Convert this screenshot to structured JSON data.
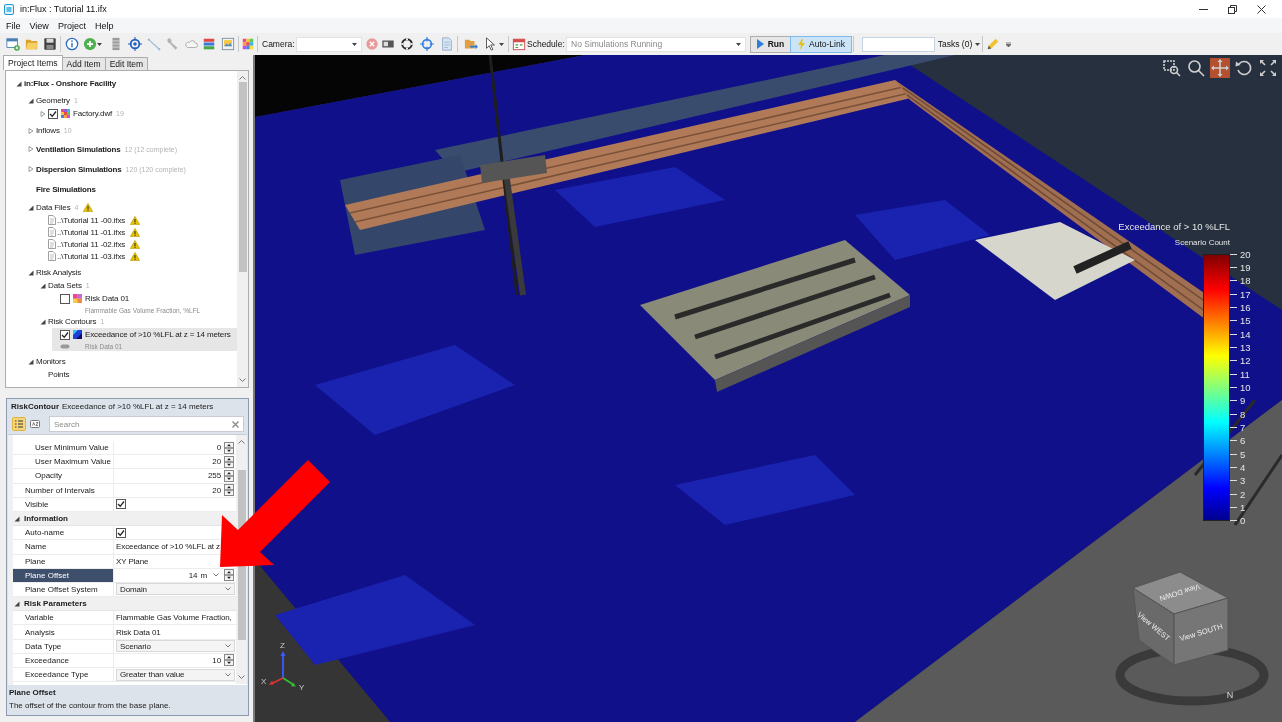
{
  "window": {
    "title": "in:Flux : Tutorial 11.ifx"
  },
  "menu": [
    "File",
    "View",
    "Project",
    "Help"
  ],
  "toolbar": {
    "camera_label": "Camera:",
    "schedule_label": "Schedule:",
    "schedule_value": "No Simulations Running",
    "run_label": "Run",
    "auto_link": {
      "label": "Auto-Link",
      "on": true
    },
    "tasks_label": "Tasks (0)"
  },
  "side_tabs": [
    {
      "label": "Project Items",
      "selected": true
    },
    {
      "label": "Add Item",
      "selected": false
    },
    {
      "label": "Edit Item",
      "selected": false
    }
  ],
  "tree": [
    {
      "label": "in:Flux - Onshore Facility",
      "kind": "root",
      "expanded": true,
      "selected": false,
      "children": [
        {
          "label": "Geometry",
          "kind": "group",
          "count": "1",
          "expanded": true,
          "warning": false,
          "selected": false,
          "children": [
            {
              "label": "Factory.dwf",
              "kind": "model",
              "count": "19",
              "expanded": false,
              "checked": true,
              "selected": false
            }
          ]
        },
        {
          "label": "Inflows",
          "kind": "group",
          "count": "10",
          "expanded": false,
          "warning": false,
          "selected": false
        },
        {
          "label": "Ventilation Simulations",
          "kind": "simulations",
          "count": "12 (12 complete)",
          "expanded": false,
          "warning": false,
          "selected": false
        },
        {
          "label": "Dispersion Simulations",
          "kind": "simulations",
          "count": "120 (120 complete)",
          "expanded": false,
          "warning": false,
          "selected": false
        },
        {
          "label": "Fire Simulations",
          "kind": "simulations",
          "warning": false,
          "selected": false
        },
        {
          "label": "Data Files",
          "kind": "group",
          "count": "4",
          "expanded": true,
          "warning": true,
          "selected": false,
          "children": [
            {
              "label": "..\\Tutorial 11 -00.ifxs",
              "kind": "file",
              "warning": true,
              "selected": false
            },
            {
              "label": "..\\Tutorial 11 -01.ifxs",
              "kind": "file",
              "warning": true,
              "selected": false
            },
            {
              "label": "..\\Tutorial 11 -02.ifxs",
              "kind": "file",
              "warning": true,
              "selected": false
            },
            {
              "label": "..\\Tutorial 11 -03.ifxs",
              "kind": "file",
              "warning": true,
              "selected": false
            }
          ]
        },
        {
          "label": "Risk Analysis",
          "kind": "group",
          "expanded": true,
          "warning": false,
          "selected": false,
          "children": [
            {
              "label": "Data Sets",
              "kind": "group",
              "count": "1",
              "expanded": true,
              "selected": false,
              "children": [
                {
                  "label": "Risk Data 01",
                  "kind": "dataset",
                  "checked": false,
                  "subtitle": "Flammable Gas Volume Fraction, %LFL",
                  "selected": false
                }
              ]
            },
            {
              "label": "Risk Contours",
              "kind": "group",
              "count": "1",
              "expanded": true,
              "selected": false,
              "children": [
                {
                  "label": "Exceedance of >10 %LFL at z = 14 meters",
                  "kind": "contour",
                  "checked": true,
                  "subtitle": "Risk Data 01",
                  "selected": true
                }
              ]
            }
          ]
        },
        {
          "label": "Monitors",
          "kind": "group",
          "expanded": true,
          "warning": false,
          "selected": false,
          "children": [
            {
              "label": "Points",
              "kind": "group",
              "selected": false
            }
          ]
        }
      ]
    }
  ],
  "properties": {
    "header": {
      "type": "RiskContour",
      "name": "Exceedance of >10 %LFL at z = 14 meters"
    },
    "view_modes": [
      {
        "kind": "categorized",
        "selected": true
      },
      {
        "kind": "alphabetical",
        "selected": false
      }
    ],
    "search": {
      "placeholder": "Search"
    },
    "groups": [
      {
        "rows": [
          {
            "kind": "nested",
            "children": [
              {
                "label": "User Minimum Value",
                "kind": "number",
                "value": "0",
                "selected": false
              },
              {
                "label": "User Maximum Value",
                "kind": "number",
                "value": "20",
                "selected": false
              },
              {
                "label": "Opacity",
                "kind": "number",
                "value": "255",
                "selected": false
              }
            ]
          },
          {
            "label": "Number of Intervals",
            "kind": "number",
            "value": "20",
            "selected": false
          },
          {
            "label": "Visible",
            "kind": "check",
            "checked": true,
            "selected": false
          }
        ]
      },
      {
        "title": "Information",
        "expanded": true,
        "rows": [
          {
            "label": "Auto-name",
            "kind": "check",
            "checked": true,
            "selected": false
          },
          {
            "label": "Name",
            "kind": "text",
            "value": "Exceedance of >10 %LFL at z",
            "selected": false
          },
          {
            "label": "Plane",
            "kind": "text",
            "value": "XY Plane",
            "selected": false
          },
          {
            "label": "Plane Offset",
            "kind": "unit-number",
            "value": "14",
            "unit": "m",
            "selected": true
          },
          {
            "label": "Plane Offset System",
            "kind": "dropdown",
            "value": "Domain",
            "selected": false
          }
        ]
      },
      {
        "title": "Risk Parameters",
        "expanded": true,
        "rows": [
          {
            "label": "Variable",
            "kind": "text",
            "value": "Flammable Gas Volume Fraction,",
            "selected": false
          },
          {
            "label": "Analysis",
            "kind": "text",
            "value": "Risk Data 01",
            "selected": false
          },
          {
            "label": "Data Type",
            "kind": "dropdown",
            "value": "Scenario",
            "selected": false
          },
          {
            "label": "Exceedance",
            "kind": "number",
            "value": "10",
            "selected": false
          },
          {
            "label": "Exceedance Type",
            "kind": "dropdown",
            "value": "Greater than value",
            "selected": false
          }
        ]
      }
    ],
    "description": {
      "title": "Plane Offset",
      "text": "The offset of the contour from the base plane."
    }
  },
  "viewport": {
    "tools": [
      {
        "kind": "zoom-window",
        "selected": false
      },
      {
        "kind": "zoom",
        "selected": false
      },
      {
        "kind": "pan",
        "selected": true
      },
      {
        "kind": "rotate",
        "selected": false
      },
      {
        "kind": "fit",
        "selected": false
      }
    ],
    "legend": {
      "title": "Exceedance of > 10 %LFL",
      "subtitle": "Scenario Count",
      "ticks": [
        "20",
        "19",
        "18",
        "17",
        "16",
        "15",
        "14",
        "13",
        "12",
        "11",
        "10",
        "9",
        "8",
        "7",
        "6",
        "5",
        "4",
        "3",
        "2",
        "1",
        "0"
      ]
    },
    "view_cube": {
      "top": "View DOWN",
      "left": "View WEST",
      "front": "View SOUTH",
      "compass": "N"
    },
    "axis_labels": {
      "x": "X",
      "y": "Y",
      "z": "Z"
    }
  },
  "annotations": [
    {
      "kind": "arrow"
    }
  ]
}
